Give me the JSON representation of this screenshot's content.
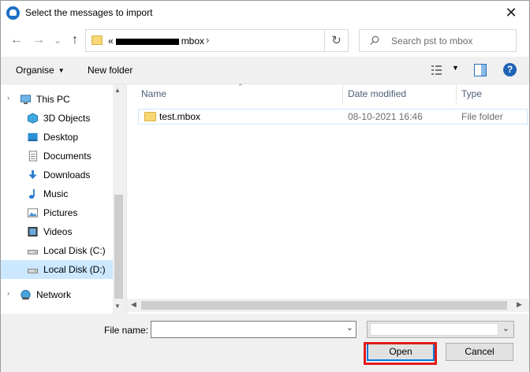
{
  "window": {
    "title": "Select the messages to import",
    "close_glyph": "✕"
  },
  "nav_buttons": {
    "back": "←",
    "forward": "→",
    "recent": "⌄",
    "up": "↑"
  },
  "address": {
    "prefix": "«",
    "path_end": "mbox",
    "chevron": "›",
    "refresh_glyph": "↻"
  },
  "search": {
    "placeholder": "Search pst to mbox"
  },
  "toolbar": {
    "organise": "Organise",
    "new_folder": "New folder",
    "help": "?"
  },
  "nav_pane": {
    "items": [
      {
        "label": "This PC",
        "icon": "computer-icon",
        "expander": "›"
      },
      {
        "label": "3D Objects",
        "icon": "3d-objects-icon"
      },
      {
        "label": "Desktop",
        "icon": "desktop-icon"
      },
      {
        "label": "Documents",
        "icon": "documents-icon"
      },
      {
        "label": "Downloads",
        "icon": "downloads-icon"
      },
      {
        "label": "Music",
        "icon": "music-icon"
      },
      {
        "label": "Pictures",
        "icon": "pictures-icon"
      },
      {
        "label": "Videos",
        "icon": "videos-icon"
      },
      {
        "label": "Local Disk (C:)",
        "icon": "drive-icon"
      },
      {
        "label": "Local Disk (D:)",
        "icon": "drive-icon",
        "selected": true
      },
      {
        "label": "Network",
        "icon": "network-icon",
        "expander": "›"
      }
    ]
  },
  "file_list": {
    "columns": [
      "Name",
      "Date modified",
      "Type"
    ],
    "rows": [
      {
        "name": "test.mbox",
        "date_modified": "08-10-2021 16:46",
        "type": "File folder"
      }
    ]
  },
  "footer": {
    "file_name_label": "File name:",
    "file_name_value": "",
    "file_type_value": "",
    "open_label": "Open",
    "cancel_label": "Cancel"
  },
  "colors": {
    "highlight_border": "#e21b1b",
    "selection": "#cce8ff",
    "accent": "#0078d7"
  }
}
